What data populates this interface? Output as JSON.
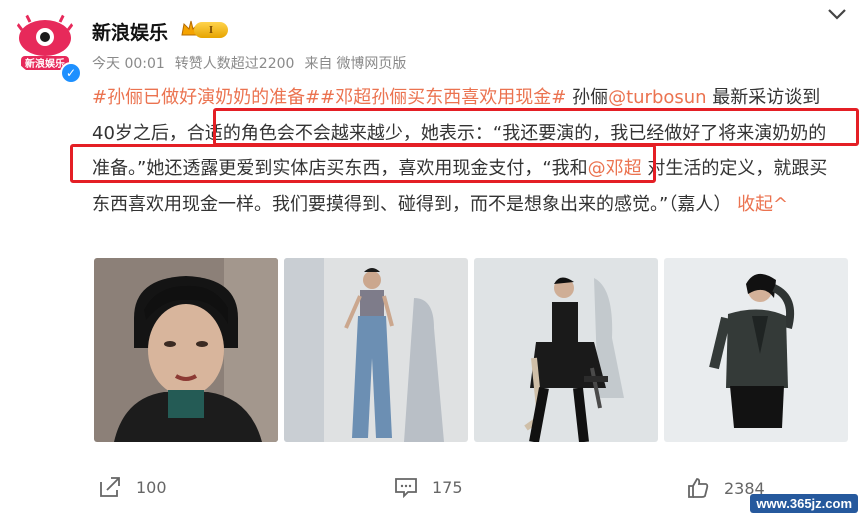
{
  "author": {
    "name": "新浪娱乐",
    "vip_level": "I",
    "avatar_icon": "sina-entertainment-logo-icon",
    "verified_icon": "verified-badge-icon"
  },
  "meta": {
    "time": "今天 00:01",
    "forwarded": "转赞人数超过2200",
    "source_prefix": "来自",
    "source": "微博网页版"
  },
  "post": {
    "tag1": "#孙俪已做好演奶奶的准备#",
    "tag2": "#邓超孙俪买东西喜欢用现金#",
    "t1": " 孙俪",
    "mention1": "@turbosun",
    "t2": " 最新采访谈到40岁之后，合适的角色会不会越来越少，她表示：“我还要演的，我已经做好了将来演奶奶的准备。”她还透露更爱到实体店买东西，喜欢用现金支付，“我和",
    "mention2": "@邓超",
    "t3": " 对生活的定义，就跟买东西喜欢用现金一样。我们要摸得到、碰得到，而不是想象出来的感觉。”（嘉人）",
    "collapse": "收起^"
  },
  "photos": [
    "photo-portrait-veil",
    "photo-denim-outfit",
    "photo-seated-dress",
    "photo-blazer-skirt"
  ],
  "actions": {
    "repost_count": "100",
    "comment_count": "175",
    "like_count": "2384"
  },
  "watermark": "www.365jz.com",
  "colors": {
    "link": "#eb7350",
    "highlight_box": "#e41f25",
    "verified": "#1e90ff"
  }
}
